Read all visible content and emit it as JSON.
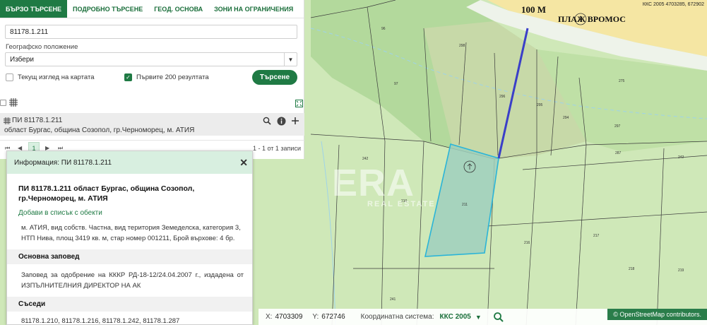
{
  "search": {
    "tabs": [
      "БЪРЗО ТЪРСЕНЕ",
      "ПОДРОБНО ТЪРСЕНЕ",
      "ГЕОД. ОСНОВА",
      "ЗОНИ НА ОГРАНИЧЕНИЯ"
    ],
    "query_value": "81178.1.211",
    "query_placeholder": "",
    "geo_label": "Географско положение",
    "geo_selected": "Избери",
    "check_current_view": "Текущ изглед на картата",
    "check_first_200": "Първите 200 резултата",
    "search_button": "Търсене"
  },
  "results": {
    "item_title": "ПИ 81178.1.211",
    "item_subtitle": "област Бургас, община Созопол, гр.Черноморец, м. АТИЯ",
    "page_current": "1",
    "pager_info": "1 - 1 от 1 записи"
  },
  "info": {
    "header": "Информация: ПИ 81178.1.211",
    "title": "ПИ 81178.1.211 област Бургас, община Созопол, гр.Черноморец, м. АТИЯ",
    "add_link": "Добави в списък с обекти",
    "description": "м. АТИЯ, вид собств. Частна, вид територия Земеделска, категория 3, НТП Нива, площ 3419 кв. м, стар номер 001211, Брой върхове: 4 бр.",
    "order_heading": "Основна заповед",
    "order_text": "Заповед за одобрение на КККР РД-18-12/24.04.2007 г., издадена от ИЗПЪЛНИТЕЛНИЯ ДИРЕКТОР НА АК",
    "neighbors_heading": "Съседи",
    "neighbors_text": "81178.1.210, 81178.1.216, 81178.1.242, 81178.1.287"
  },
  "map": {
    "annotation_distance": "100 М",
    "annotation_beach": "ПЛАЖ ВРОМОС",
    "crs_top": "ККС 2005 4703285, 672902",
    "watermark": "ERA",
    "watermark_sub": "REAL ESTATE",
    "parcel_labels": [
      "96",
      "298",
      "97",
      "296",
      "295",
      "294",
      "297",
      "287",
      "210",
      "211",
      "216",
      "217",
      "218",
      "219",
      "241",
      "242",
      "242",
      "275"
    ],
    "parcel_colors": {
      "selected_fill": "#9fcfbd",
      "selected_stroke": "#2ab4d8",
      "measure_line": "#3a3fc8",
      "beach": "#f5e6a3"
    }
  },
  "status": {
    "x_label": "X:",
    "x_value": "4703309",
    "y_label": "Y:",
    "y_value": "672746",
    "crs_label": "Координатна система:",
    "crs_value": "ККС 2005",
    "osm": "© OpenStreetMap contributors."
  }
}
